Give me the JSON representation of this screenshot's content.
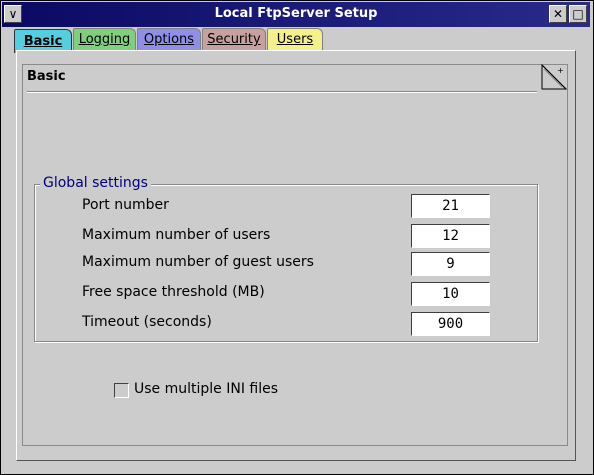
{
  "window": {
    "title": "Local FtpServer Setup",
    "menu_glyph": "∨",
    "close_glyph": "✕",
    "maximize_glyph": "□"
  },
  "tabs": [
    {
      "label": "Basic",
      "color": "#55cfe0",
      "active": true
    },
    {
      "label": "Logging",
      "color": "#7fcf7f",
      "active": false
    },
    {
      "label": "Options",
      "color": "#8f8fe8",
      "active": false
    },
    {
      "label": "Security",
      "color": "#c8a0a0",
      "active": false
    },
    {
      "label": "Users",
      "color": "#f4f08c",
      "active": false
    }
  ],
  "page": {
    "title": "Basic"
  },
  "global_settings": {
    "label": "Global settings",
    "fields": [
      {
        "label": "Port number",
        "value": "21"
      },
      {
        "label": "Maximum number of users",
        "value": "12"
      },
      {
        "label": "Maximum number of guest users",
        "value": "9"
      },
      {
        "label": "Free space threshold (MB)",
        "value": "10"
      },
      {
        "label": "Timeout (seconds)",
        "value": "900"
      }
    ]
  },
  "options": {
    "multiple_ini_label": "Use multiple INI files",
    "multiple_ini_checked": false
  }
}
